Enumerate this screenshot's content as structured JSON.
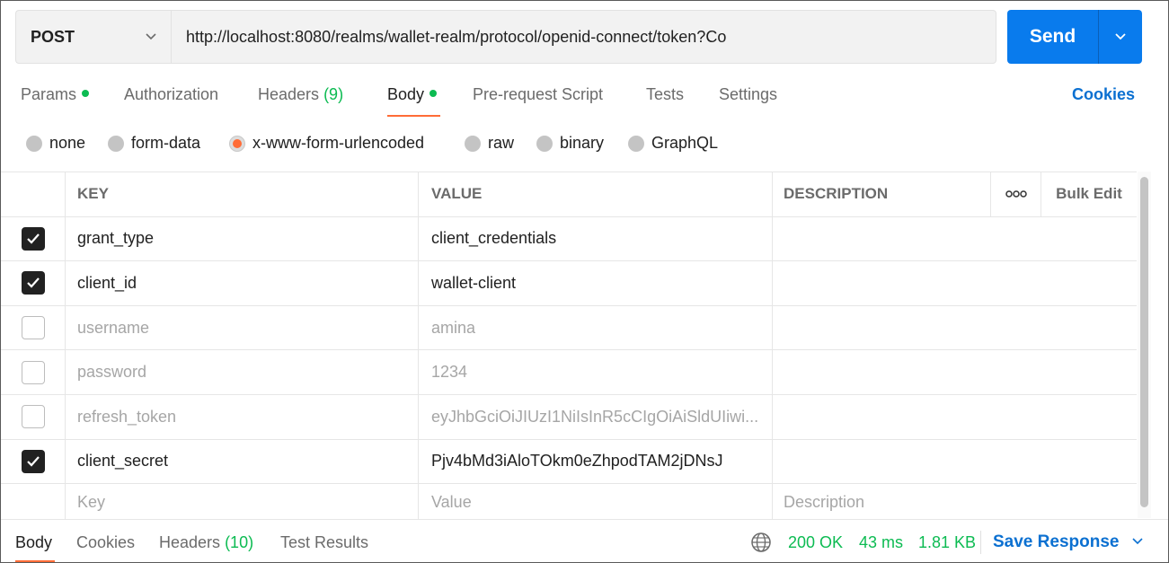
{
  "request": {
    "method": "POST",
    "url": "http://localhost:8080/realms/wallet-realm/protocol/openid-connect/token?Co",
    "send_label": "Send"
  },
  "tabs": {
    "params": "Params",
    "authorization": "Authorization",
    "headers": "Headers",
    "headers_count": "(9)",
    "body": "Body",
    "prerequest": "Pre-request Script",
    "tests": "Tests",
    "settings": "Settings",
    "cookies": "Cookies"
  },
  "body_types": [
    "none",
    "form-data",
    "x-www-form-urlencoded",
    "raw",
    "binary",
    "GraphQL"
  ],
  "body_type_selected": "x-www-form-urlencoded",
  "table": {
    "headers": {
      "key": "KEY",
      "value": "VALUE",
      "description": "DESCRIPTION",
      "bulk_edit": "Bulk Edit"
    },
    "rows": [
      {
        "enabled": true,
        "key": "grant_type",
        "value": "client_credentials"
      },
      {
        "enabled": true,
        "key": "client_id",
        "value": "wallet-client"
      },
      {
        "enabled": false,
        "key": "username",
        "value": "amina"
      },
      {
        "enabled": false,
        "key": "password",
        "value": "1234"
      },
      {
        "enabled": false,
        "key": "refresh_token",
        "value": "eyJhbGciOiJIUzI1NiIsInR5cCIgOiAiSldUIiwi..."
      },
      {
        "enabled": true,
        "key": "client_secret",
        "value": "Pjv4bMd3iAloTOkm0eZhpodTAM2jDNsJ"
      }
    ],
    "placeholder": {
      "key": "Key",
      "value": "Value",
      "description": "Description"
    }
  },
  "footer": {
    "body": "Body",
    "cookies": "Cookies",
    "headers": "Headers",
    "headers_count": "(10)",
    "test_results": "Test Results",
    "status": "200 OK",
    "time": "43 ms",
    "size": "1.81 KB",
    "save_response": "Save Response"
  },
  "colors": {
    "accent": "#ff6c37",
    "primary": "#097bed",
    "link": "#0b70d1",
    "success": "#0cbb52"
  }
}
